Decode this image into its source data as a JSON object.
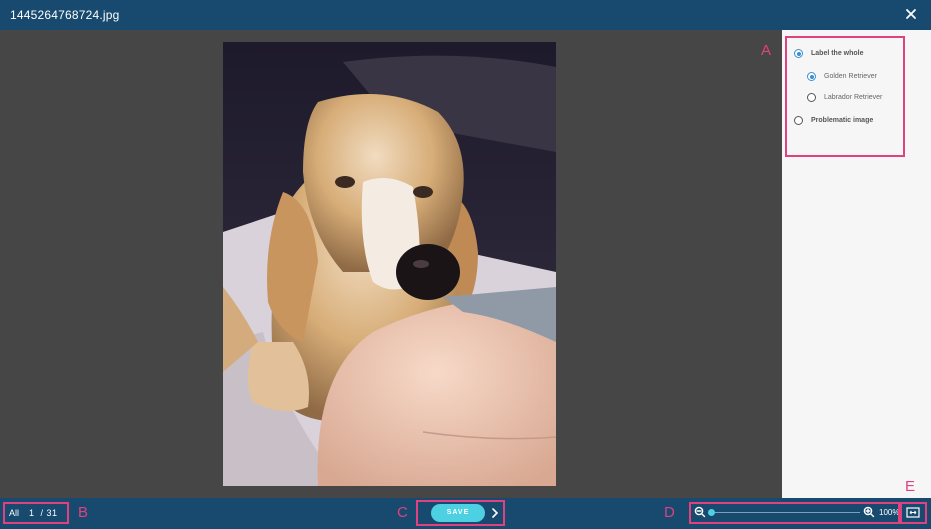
{
  "window": {
    "title": "1445264768724.jpg"
  },
  "panel": {
    "options": [
      {
        "label": "Label the whole",
        "checked": true
      },
      {
        "label": "Golden Retriever",
        "checked": true
      },
      {
        "label": "Labrador Retriever",
        "checked": false
      },
      {
        "label": "Problematic image",
        "checked": false
      }
    ]
  },
  "bottom": {
    "filter": "All",
    "pager": "1  / 31",
    "save_label": "SAVE",
    "zoom": "100%"
  },
  "annotations": [
    "A",
    "B",
    "C",
    "D",
    "E"
  ],
  "colors": {
    "bar": "#174a6e",
    "accent": "#4dd0e1",
    "highlight": "#e0417f",
    "radio": "#3a8fd0"
  }
}
